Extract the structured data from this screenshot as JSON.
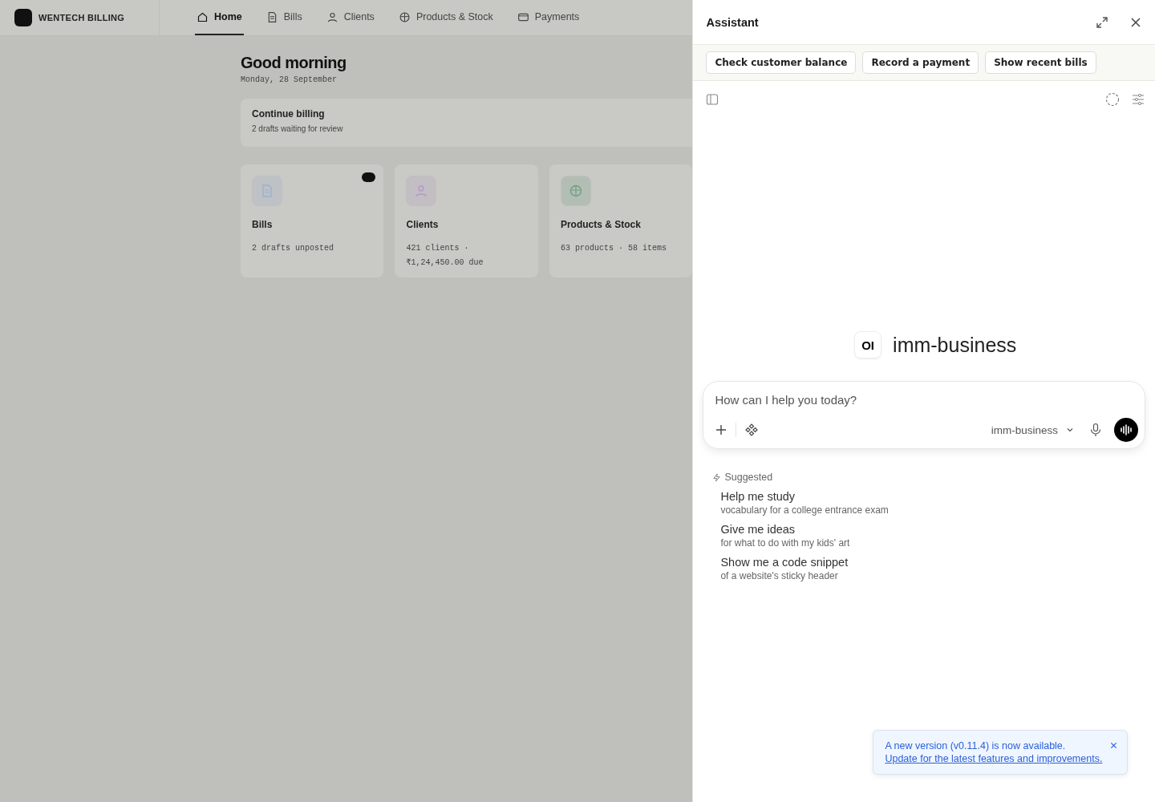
{
  "app": {
    "brand": "WENTECH BILLING",
    "nav": [
      {
        "label": "Home",
        "kind": "home",
        "selected": true
      },
      {
        "label": "Bills",
        "kind": "doc",
        "selected": false
      },
      {
        "label": "Clients",
        "kind": "person",
        "selected": false
      },
      {
        "label": "Products & Stock",
        "kind": "box",
        "selected": false
      },
      {
        "label": "Payments",
        "kind": "wallet",
        "selected": false
      }
    ],
    "greeting": "Good morning",
    "date": "Monday, 28 September",
    "banner": {
      "title": "Continue billing",
      "subtitle": "2 drafts waiting for review"
    },
    "cards": [
      {
        "title": "Bills",
        "detail": "2 drafts unposted",
        "kind": "doc",
        "color": "#9fb0c8",
        "badge": true
      },
      {
        "title": "Clients",
        "detail": "421 clients · ₹1,24,450.00 due",
        "kind": "person",
        "color": "#b59abf",
        "badge": false
      },
      {
        "title": "Products & Stock",
        "detail": "63 products · 58 items",
        "kind": "box",
        "color": "#6f9f80",
        "badge": false
      }
    ]
  },
  "assistant": {
    "title": "Assistant",
    "quick_actions": [
      "Check customer balance",
      "Record a payment",
      "Show recent bills"
    ],
    "logo_text": "OI",
    "model_name": "imm-business",
    "input": {
      "placeholder": "How can I help you today?",
      "model": "imm-business"
    },
    "suggested_label": "Suggested",
    "suggestions": [
      {
        "title": "Help me study",
        "detail": "vocabulary for a college entrance exam"
      },
      {
        "title": "Give me ideas",
        "detail": "for what to do with my kids' art"
      },
      {
        "title": "Show me a code snippet",
        "detail": "of a website's sticky header"
      }
    ],
    "toast": {
      "message": "A new version (v0.11.4) is now available.",
      "link": "Update for the latest features and improvements."
    }
  }
}
